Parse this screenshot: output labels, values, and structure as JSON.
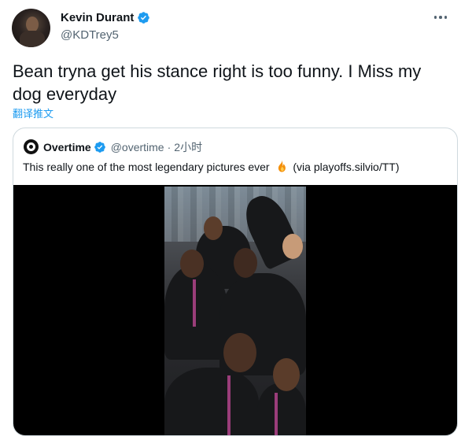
{
  "tweet": {
    "author": {
      "display_name": "Kevin Durant",
      "handle": "@KDTrey5",
      "verified": true
    },
    "text": "Bean tryna get his stance right is too funny. I Miss my dog everyday",
    "translate_label": "翻译推文",
    "more_icon": "more-horizontal-icon"
  },
  "quote": {
    "author": {
      "display_name": "Overtime",
      "handle": "@overtime",
      "verified": true
    },
    "separator": "·",
    "time": "2小时",
    "text_before": "This really one of the most legendary pictures ever",
    "emoji": "fire-icon",
    "text_after": "(via playoffs.silvio/TT)"
  },
  "colors": {
    "text": "#0f1419",
    "secondary": "#536471",
    "accent": "#1d9bf0",
    "border": "#cfd9de",
    "media_bg": "#000000"
  }
}
